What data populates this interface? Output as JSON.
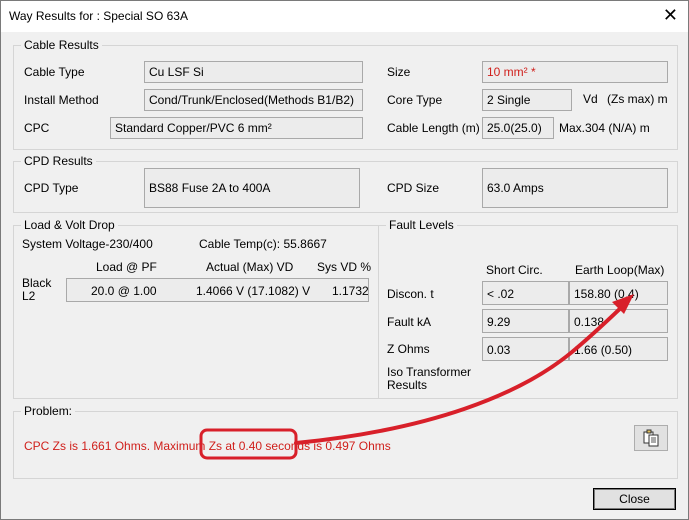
{
  "window": {
    "title": "Way Results for : Special SO 63A",
    "close_glyph": "✕"
  },
  "cable_results": {
    "title": "Cable Results",
    "cable_type_label": "Cable Type",
    "cable_type_value": "Cu LSF  Si",
    "install_method_label": "Install Method",
    "install_method_value": "Cond/Trunk/Enclosed(Methods B1/B2)",
    "cpc_label": "CPC",
    "cpc_value": "Standard Copper/PVC 6 mm²",
    "size_label": "Size",
    "size_value": "10 mm² *",
    "core_type_label": "Core Type",
    "core_type_value": "2 Single",
    "vd_label": "Vd",
    "zs_max_label": "(Zs max) m",
    "cable_length_label": "Cable Length (m)",
    "cable_length_value": "25.0(25.0)",
    "max_value": "Max.304 (N/A) m"
  },
  "cpd_results": {
    "title": "CPD Results",
    "cpd_type_label": "CPD Type",
    "cpd_type_value": "BS88 Fuse 2A to 400A",
    "cpd_size_label": "CPD Size",
    "cpd_size_value": "63.0 Amps"
  },
  "load_volt_drop": {
    "title": "Load & Volt Drop",
    "system_voltage": "System Voltage-230/400",
    "cable_temp": "Cable Temp(c): 55.8667",
    "col_load": "Load @ PF",
    "col_actual": "Actual (Max) VD",
    "col_sys": "Sys VD %",
    "row_label_1": "Black",
    "row_label_2": "L2",
    "load_value": "20.0 @ 1.00",
    "actual_value": "1.4066  V   (17.1082)  V",
    "sys_value": "1.1732"
  },
  "fault_levels": {
    "title": "Fault Levels",
    "col_short": "Short Circ.",
    "col_earth": "Earth Loop(Max)",
    "discon_label": "Discon. t",
    "discon_short": "< .02",
    "discon_earth": "158.80 (0.4)",
    "fault_ka_label": "Fault kA",
    "fault_ka_short": "9.29",
    "fault_ka_earth": "0.138",
    "z_ohms_label": "Z Ohms",
    "z_ohms_short": "0.03",
    "z_ohms_earth": "1.66 (0.50)",
    "iso_label_1": "Iso Transformer",
    "iso_label_2": "Results"
  },
  "problem": {
    "title": "Problem:",
    "message": "CPC Zs is 1.661 Ohms. Maximum Zs at 0.40 seconds is 0.497 Ohms"
  },
  "buttons": {
    "close_label": "Close"
  },
  "colors": {
    "error_text": "#d0201c",
    "annotation": "#d8202a"
  }
}
